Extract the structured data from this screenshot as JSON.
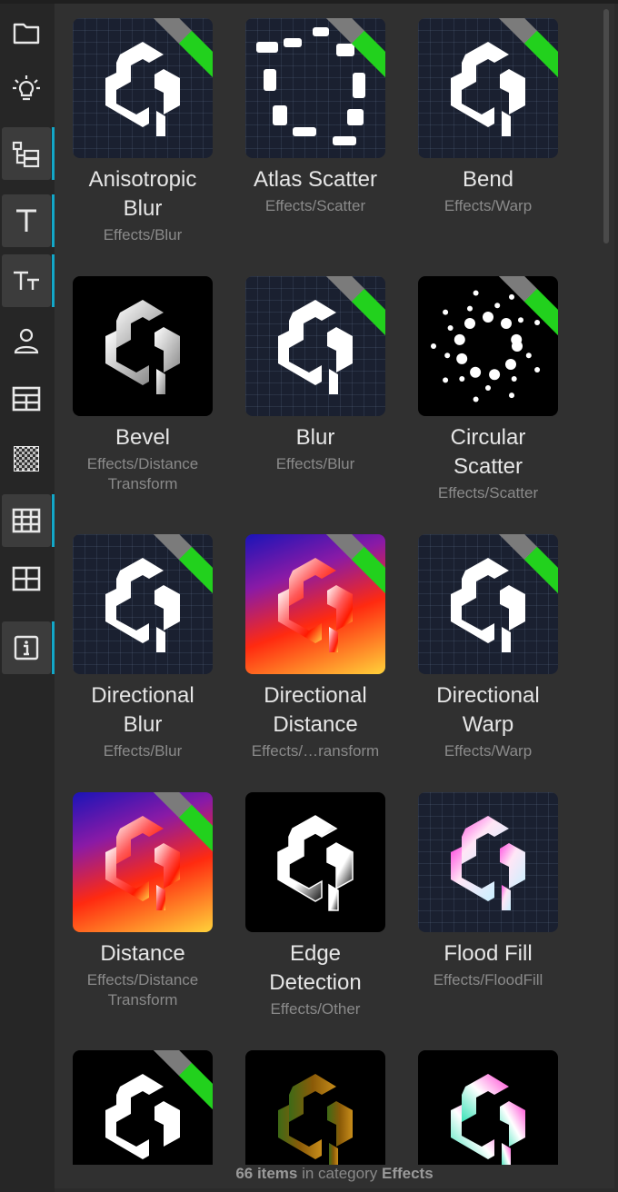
{
  "sidebar": {
    "items": [
      {
        "icon": "folder-icon",
        "active": false
      },
      {
        "icon": "lightbulb-icon",
        "active": false
      },
      {
        "icon": "hierarchy-icon",
        "active": true
      },
      {
        "icon": "text-icon",
        "active": true
      },
      {
        "icon": "text-size-icon",
        "active": true
      },
      {
        "icon": "person-icon",
        "active": false
      },
      {
        "icon": "table-icon",
        "active": false
      },
      {
        "icon": "checker-icon",
        "active": false
      },
      {
        "icon": "grid-icon",
        "active": true
      },
      {
        "icon": "grid-2x2-icon",
        "active": false
      },
      {
        "icon": "info-icon",
        "active": true
      }
    ],
    "accent_color": "#12a7c8"
  },
  "items": [
    {
      "title": "Anisotropic Blur",
      "lines": [
        "Anisotropic",
        "Blur"
      ],
      "category": "Effects/Blur",
      "cat_lines": [
        "Effects/Blur"
      ],
      "style": "white",
      "ribbon": true
    },
    {
      "title": "Atlas Scatter",
      "lines": [
        "Atlas Scatter"
      ],
      "category": "Effects/Scatter",
      "cat_lines": [
        "Effects/Scatter"
      ],
      "style": "scatter",
      "ribbon": true
    },
    {
      "title": "Bend",
      "lines": [
        "Bend"
      ],
      "category": "Effects/Warp",
      "cat_lines": [
        "Effects/Warp"
      ],
      "style": "white",
      "ribbon": true
    },
    {
      "title": "Bevel",
      "lines": [
        "Bevel"
      ],
      "category": "Effects/Distance Transform",
      "cat_lines": [
        "Effects/Distance",
        "Transform"
      ],
      "style": "bevel",
      "ribbon": false
    },
    {
      "title": "Blur",
      "lines": [
        "Blur"
      ],
      "category": "Effects/Blur",
      "cat_lines": [
        "Effects/Blur"
      ],
      "style": "white",
      "ribbon": true
    },
    {
      "title": "Circular Scatter",
      "lines": [
        "Circular",
        "Scatter"
      ],
      "category": "Effects/Scatter",
      "cat_lines": [
        "Effects/Scatter"
      ],
      "style": "circular",
      "ribbon": true
    },
    {
      "title": "Directional Blur",
      "lines": [
        "Directional",
        "Blur"
      ],
      "category": "Effects/Blur",
      "cat_lines": [
        "Effects/Blur"
      ],
      "style": "white",
      "ribbon": true
    },
    {
      "title": "Directional Distance",
      "lines": [
        "Directional",
        "Distance"
      ],
      "category": "Effects/…ransform",
      "cat_lines": [
        "Effects/…ransform"
      ],
      "style": "rainbow",
      "ribbon": true
    },
    {
      "title": "Directional Warp",
      "lines": [
        "Directional",
        "Warp"
      ],
      "category": "Effects/Warp",
      "cat_lines": [
        "Effects/Warp"
      ],
      "style": "white",
      "ribbon": true
    },
    {
      "title": "Distance",
      "lines": [
        "Distance"
      ],
      "category": "Effects/Distance Transform",
      "cat_lines": [
        "Effects/Distance",
        "Transform"
      ],
      "style": "rainbow",
      "ribbon": true
    },
    {
      "title": "Edge Detection",
      "lines": [
        "Edge",
        "Detection"
      ],
      "category": "Effects/Other",
      "cat_lines": [
        "Effects/Other"
      ],
      "style": "edge",
      "ribbon": false
    },
    {
      "title": "Flood Fill",
      "lines": [
        "Flood Fill"
      ],
      "category": "Effects/FloodFill",
      "cat_lines": [
        "Effects/FloodFill"
      ],
      "style": "flood",
      "ribbon": false
    },
    {
      "title": "",
      "lines": [],
      "category": "",
      "cat_lines": [],
      "style": "partial",
      "ribbon": true
    },
    {
      "title": "",
      "lines": [],
      "category": "",
      "cat_lines": [],
      "style": "olive",
      "ribbon": false
    },
    {
      "title": "",
      "lines": [],
      "category": "",
      "cat_lines": [],
      "style": "gradient",
      "ribbon": false
    }
  ],
  "footer": {
    "count": "66 items",
    "middle": " in category ",
    "category": "Effects"
  },
  "colors": {
    "ribbon_gray": "#7b7b7b",
    "ribbon_green": "#22d11d",
    "panel_bg": "#303030"
  }
}
